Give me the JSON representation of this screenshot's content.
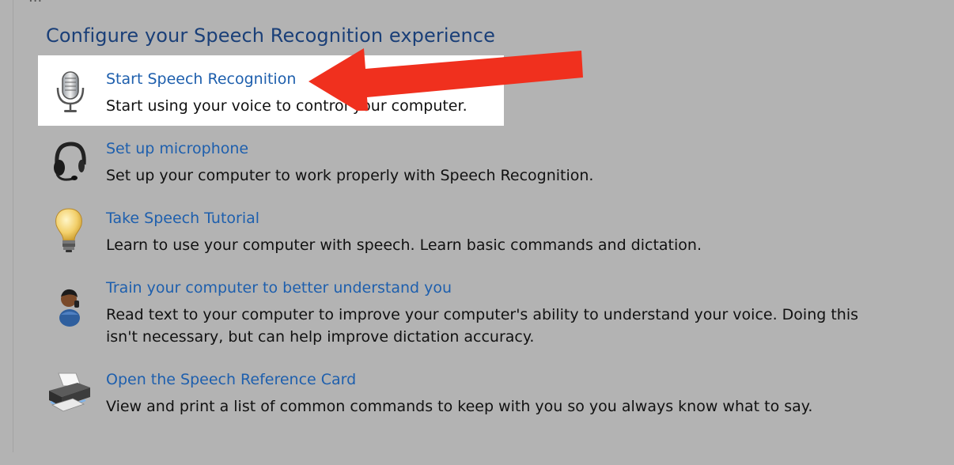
{
  "header": {
    "fragment": "...",
    "title": "Configure your Speech Recognition experience"
  },
  "tasks": [
    {
      "link": "Start Speech Recognition",
      "description": "Start using your voice to control your computer.",
      "icon": "microphone-icon"
    },
    {
      "link": "Set up microphone",
      "description": "Set up your computer to work properly with Speech Recognition.",
      "icon": "headset-icon"
    },
    {
      "link": "Take Speech Tutorial",
      "description": "Learn to use your computer with speech.  Learn basic commands and dictation.",
      "icon": "lightbulb-icon"
    },
    {
      "link": "Train your computer to better understand you",
      "description": "Read text to your computer to improve your computer's ability to understand your voice.  Doing this isn't necessary, but can help improve dictation accuracy.",
      "icon": "user-train-icon"
    },
    {
      "link": "Open the Speech Reference Card",
      "description": "View and print a list of common commands to keep with you so you always know what to say.",
      "icon": "printer-icon"
    }
  ],
  "annotation": {
    "highlighted_task": "Start Speech Recognition",
    "arrow_color": "#f0301e"
  },
  "colors": {
    "background": "#b3b3b3",
    "link": "#1e5fad",
    "title": "#1a3f78",
    "highlight": "#ffffff"
  }
}
